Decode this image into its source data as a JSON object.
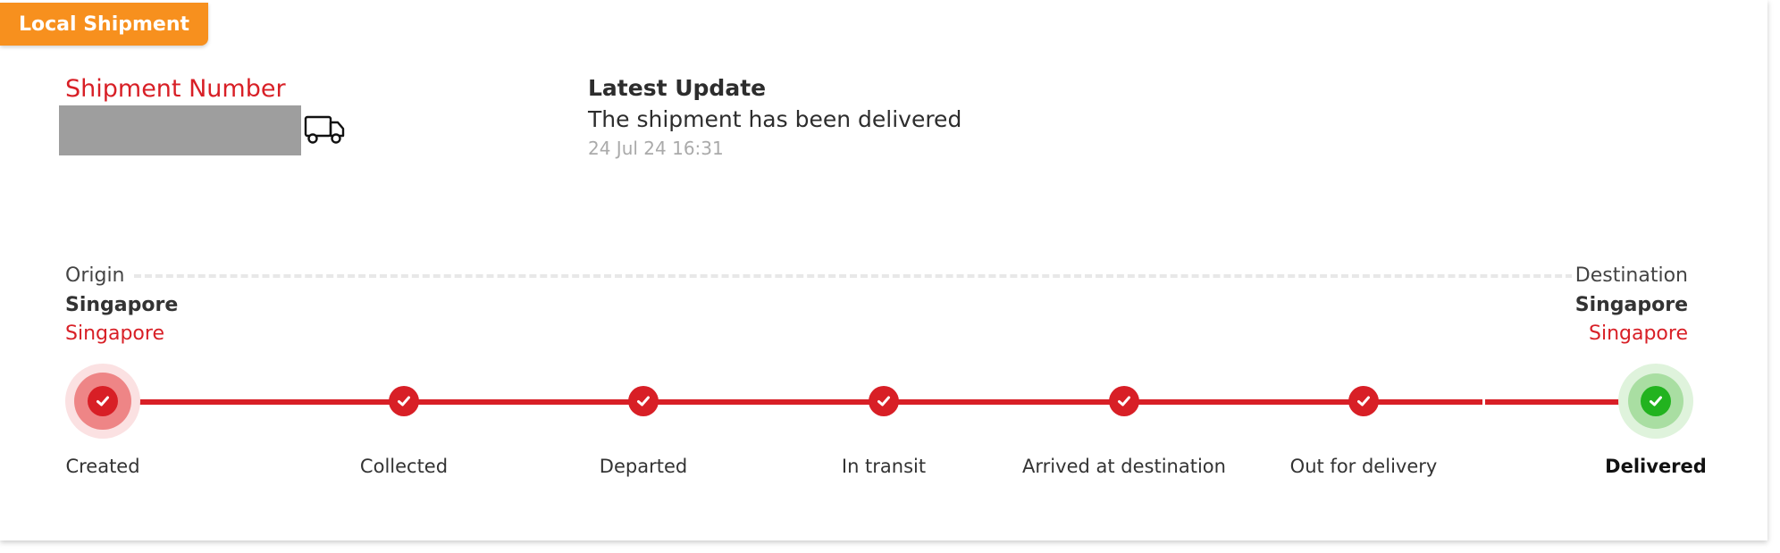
{
  "badge": {
    "label": "Local Shipment"
  },
  "shipment": {
    "number_label": "Shipment Number",
    "icon": "truck-icon"
  },
  "latest_update": {
    "title": "Latest Update",
    "status": "The shipment has been delivered",
    "timestamp": "24 Jul 24 16:31"
  },
  "origin": {
    "label": "Origin",
    "city": "Singapore",
    "country": "Singapore"
  },
  "destination": {
    "label": "Destination",
    "city": "Singapore",
    "country": "Singapore"
  },
  "steps": [
    {
      "label": "Created",
      "state": "done"
    },
    {
      "label": "Collected",
      "state": "done"
    },
    {
      "label": "Departed",
      "state": "done"
    },
    {
      "label": "In transit",
      "state": "done"
    },
    {
      "label": "Arrived at destination",
      "state": "done"
    },
    {
      "label": "Out for delivery",
      "state": "done"
    },
    {
      "label": "Delivered",
      "state": "current"
    }
  ],
  "colors": {
    "accent_orange": "#f7901e",
    "accent_red": "#d81f26",
    "success_green": "#22b31f",
    "redacted_gray": "#9e9e9e"
  }
}
